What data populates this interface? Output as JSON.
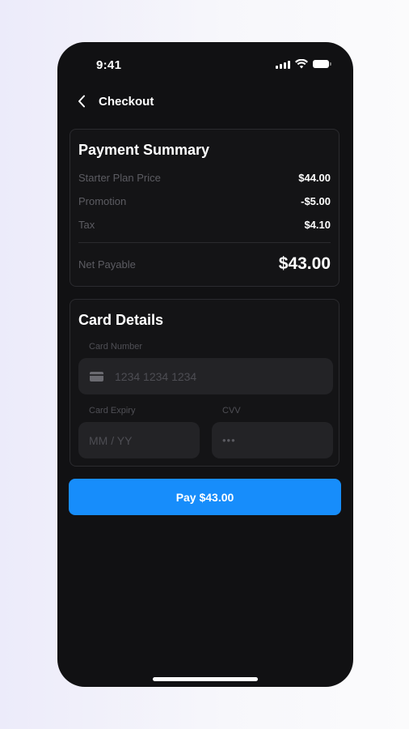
{
  "status_bar": {
    "time": "9:41",
    "icons": [
      "signal-icon",
      "wifi-icon",
      "battery-icon"
    ]
  },
  "header": {
    "back_icon": "chevron-left-icon",
    "title": "Checkout"
  },
  "payment_summary": {
    "title": "Payment Summary",
    "rows": [
      {
        "label": "Starter Plan Price",
        "value": "$44.00"
      },
      {
        "label": "Promotion",
        "value": "-$5.00"
      },
      {
        "label": "Tax",
        "value": "$4.10"
      }
    ],
    "net": {
      "label": "Net Payable",
      "value": "$43.00"
    }
  },
  "card_details": {
    "title": "Card Details",
    "card_number": {
      "label": "Card Number",
      "placeholder": "1234 1234 1234",
      "icon": "credit-card-icon"
    },
    "card_expiry": {
      "label": "Card Expiry",
      "placeholder": "MM / YY"
    },
    "cvv": {
      "label": "CVV",
      "placeholder": "•••"
    }
  },
  "pay_button": {
    "label": "Pay $43.00"
  },
  "colors": {
    "accent": "#178dfb",
    "screen_background": "#111113",
    "card_background": "#141416",
    "field_background": "#232326",
    "muted_text": "#5c5c62"
  }
}
